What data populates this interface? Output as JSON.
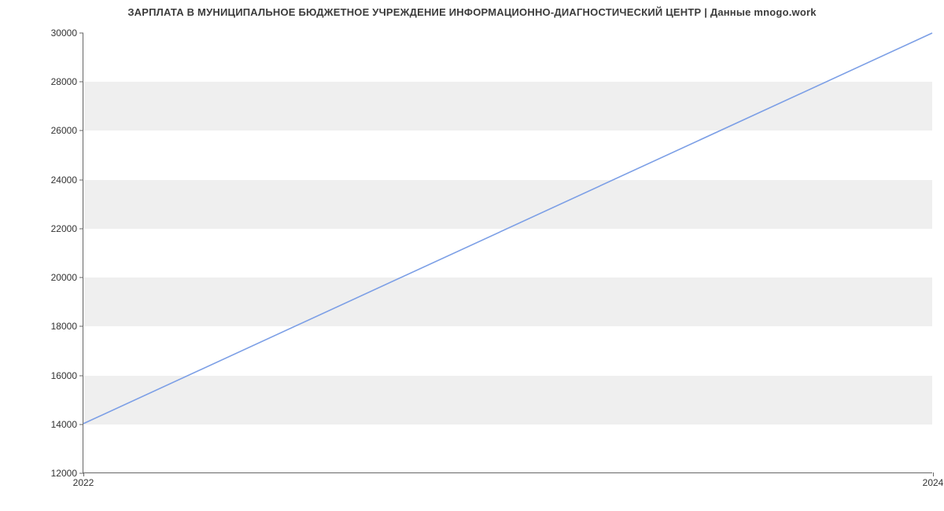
{
  "chart_data": {
    "type": "line",
    "title": "ЗАРПЛАТА В МУНИЦИПАЛЬНОЕ БЮДЖЕТНОЕ УЧРЕЖДЕНИЕ ИНФОРМАЦИОННО-ДИАГНОСТИЧЕСКИЙ ЦЕНТР | Данные mnogo.work",
    "x": [
      2022,
      2024
    ],
    "y": [
      14000,
      30000
    ],
    "xlabel": "",
    "ylabel": "",
    "xlim": [
      2022,
      2024
    ],
    "ylim": [
      12000,
      30000
    ],
    "y_ticks": [
      12000,
      14000,
      16000,
      18000,
      20000,
      22000,
      24000,
      26000,
      28000,
      30000
    ],
    "x_ticks": [
      2022,
      2024
    ],
    "line_color": "#7c9fe6",
    "band_color": "#efefef",
    "grid": true
  }
}
